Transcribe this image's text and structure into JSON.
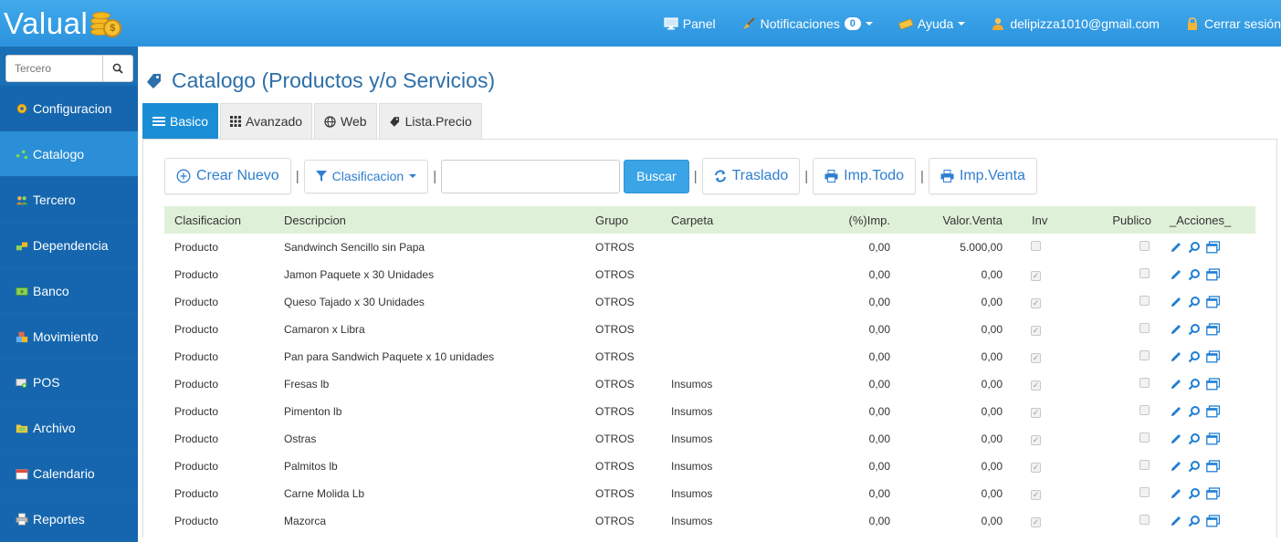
{
  "app": {
    "logo_text": "Valual",
    "logo_coin_symbol": "$"
  },
  "topnav": {
    "panel": "Panel",
    "notificaciones": "Notificaciones",
    "notificaciones_count": "0",
    "ayuda": "Ayuda",
    "user_email": "delipizza1010@gmail.com",
    "logout": "Cerrar sesión"
  },
  "sidebar": {
    "search_placeholder": "Tercero",
    "items": [
      {
        "label": "Configuracion",
        "icon": "gear-icon"
      },
      {
        "label": "Catalogo",
        "icon": "network-icon"
      },
      {
        "label": "Tercero",
        "icon": "people-icon"
      },
      {
        "label": "Dependencia",
        "icon": "blocks-icon"
      },
      {
        "label": "Banco",
        "icon": "money-icon"
      },
      {
        "label": "Movimiento",
        "icon": "boxes-icon"
      },
      {
        "label": "POS",
        "icon": "cart-icon"
      },
      {
        "label": "Archivo",
        "icon": "folder-icon"
      },
      {
        "label": "Calendario",
        "icon": "calendar-icon"
      },
      {
        "label": "Reportes",
        "icon": "printer-icon"
      }
    ],
    "active_index": 1
  },
  "page": {
    "title": "Catalogo (Productos y/o Servicios)"
  },
  "tabs": [
    {
      "label": "Basico",
      "icon": "list-icon"
    },
    {
      "label": "Avanzado",
      "icon": "grid-icon"
    },
    {
      "label": "Web",
      "icon": "globe-icon"
    },
    {
      "label": "Lista.Precio",
      "icon": "tag-icon"
    }
  ],
  "toolbar": {
    "crear_nuevo": "Crear Nuevo",
    "clasificacion": "Clasificacion",
    "buscar": "Buscar",
    "traslado": "Traslado",
    "imp_todo": "Imp.Todo",
    "imp_venta": "Imp.Venta",
    "separator": "|",
    "search_value": ""
  },
  "table": {
    "headers": [
      "Clasificacion",
      "Descripcion",
      "Grupo",
      "Carpeta",
      "(%)Imp.",
      "Valor.Venta",
      "Inv",
      "Publico",
      "_Acciones_"
    ],
    "rows": [
      {
        "clasificacion": "Producto",
        "descripcion": "Sandwinch Sencillo sin Papa",
        "grupo": "OTROS",
        "carpeta": "",
        "imp": "0,00",
        "valor": "5.000,00",
        "inv": false,
        "publico": false
      },
      {
        "clasificacion": "Producto",
        "descripcion": "Jamon Paquete x 30 Unidades",
        "grupo": "OTROS",
        "carpeta": "",
        "imp": "0,00",
        "valor": "0,00",
        "inv": true,
        "publico": false
      },
      {
        "clasificacion": "Producto",
        "descripcion": "Queso Tajado x 30 Unidades",
        "grupo": "OTROS",
        "carpeta": "",
        "imp": "0,00",
        "valor": "0,00",
        "inv": true,
        "publico": false
      },
      {
        "clasificacion": "Producto",
        "descripcion": "Camaron x Libra",
        "grupo": "OTROS",
        "carpeta": "",
        "imp": "0,00",
        "valor": "0,00",
        "inv": true,
        "publico": false
      },
      {
        "clasificacion": "Producto",
        "descripcion": "Pan para Sandwich Paquete x 10 unidades",
        "grupo": "OTROS",
        "carpeta": "",
        "imp": "0,00",
        "valor": "0,00",
        "inv": true,
        "publico": false
      },
      {
        "clasificacion": "Producto",
        "descripcion": "Fresas lb",
        "grupo": "OTROS",
        "carpeta": "Insumos",
        "imp": "0,00",
        "valor": "0,00",
        "inv": true,
        "publico": false
      },
      {
        "clasificacion": "Producto",
        "descripcion": "Pimenton lb",
        "grupo": "OTROS",
        "carpeta": "Insumos",
        "imp": "0,00",
        "valor": "0,00",
        "inv": true,
        "publico": false
      },
      {
        "clasificacion": "Producto",
        "descripcion": "Ostras",
        "grupo": "OTROS",
        "carpeta": "Insumos",
        "imp": "0,00",
        "valor": "0,00",
        "inv": true,
        "publico": false
      },
      {
        "clasificacion": "Producto",
        "descripcion": "Palmitos lb",
        "grupo": "OTROS",
        "carpeta": "Insumos",
        "imp": "0,00",
        "valor": "0,00",
        "inv": true,
        "publico": false
      },
      {
        "clasificacion": "Producto",
        "descripcion": "Carne Molida Lb",
        "grupo": "OTROS",
        "carpeta": "Insumos",
        "imp": "0,00",
        "valor": "0,00",
        "inv": true,
        "publico": false
      },
      {
        "clasificacion": "Producto",
        "descripcion": "Mazorca",
        "grupo": "OTROS",
        "carpeta": "Insumos",
        "imp": "0,00",
        "valor": "0,00",
        "inv": true,
        "publico": false
      }
    ]
  },
  "colors": {
    "topbar": "#2b93dd",
    "sidebar": "#1566ae",
    "sidebar_active": "#2a8fd6",
    "title": "#2d6fa8",
    "link": "#2f7fd0",
    "table_header": "#dff0d8"
  }
}
